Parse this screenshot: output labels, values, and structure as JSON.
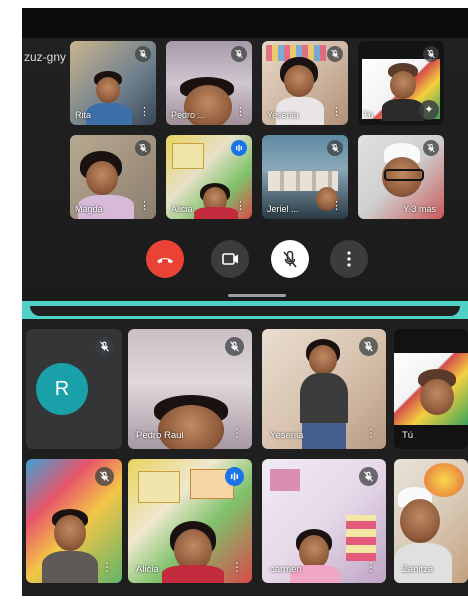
{
  "meeting": {
    "code": "zuz-gny"
  },
  "top_grid": {
    "tiles": [
      {
        "name": "Rita",
        "muted": true
      },
      {
        "name": "Pedro ...",
        "muted": true
      },
      {
        "name": "Yesenia",
        "muted": true
      },
      {
        "name": "Tú",
        "muted": true
      },
      {
        "name": "Magda",
        "muted": true
      },
      {
        "name": "Alicia",
        "speaking": true
      },
      {
        "name": "Jeriel ...",
        "muted": true
      },
      {
        "name": "Y 3 más",
        "muted": true
      }
    ]
  },
  "controls": {
    "end_call": "phone-hangup-icon",
    "camera": "camera-icon",
    "mic": "mic-off-icon",
    "more": "more-vert-icon"
  },
  "bottom_grid": {
    "tiles": [
      {
        "name": "R",
        "muted": true,
        "avatar": true
      },
      {
        "name": "Pedro Raul",
        "muted": true
      },
      {
        "name": "Yesenia",
        "muted": true
      },
      {
        "name": "Tú",
        "muted": false
      },
      {
        "name": "",
        "muted": true
      },
      {
        "name": "Alicia",
        "speaking": true
      },
      {
        "name": "carmen",
        "muted": true
      },
      {
        "name": "Zanitza",
        "muted": false
      }
    ]
  },
  "colors": {
    "end_call_red": "#ea4335",
    "speaking_blue": "#1a73e8",
    "divider_teal": "#4fd1c5",
    "avatar_teal": "#1aa0a8"
  }
}
